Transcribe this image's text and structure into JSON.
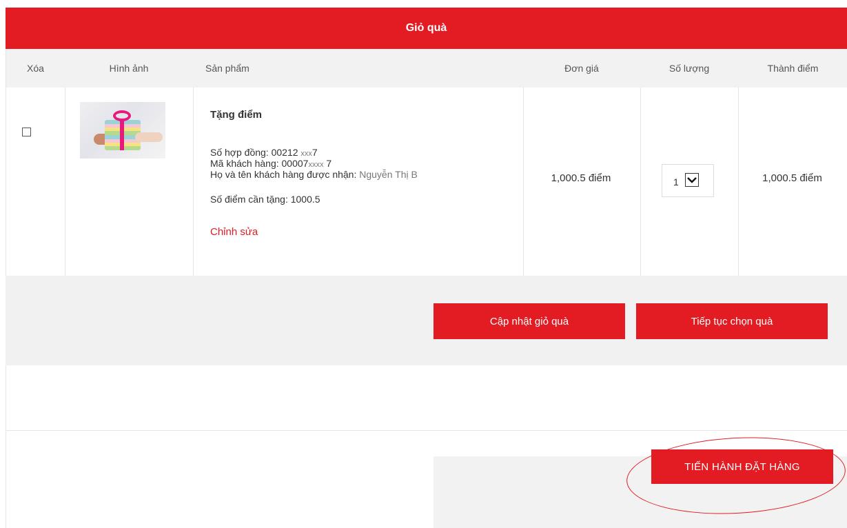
{
  "header": {
    "title": "Giỏ quà"
  },
  "table": {
    "columns": [
      "Xóa",
      "Hình ảnh",
      "Sản phẩm",
      "Đơn giá",
      "Số lượng",
      "Thành điểm"
    ],
    "row": {
      "product_title": "Tặng điểm",
      "contract_label": "Số hợp đồng: 00212",
      "contract_masked": "xxx",
      "contract_suffix": "7",
      "customer_label": "Mã khách hàng: 00007",
      "customer_masked": "xxxx",
      "customer_suffix": " 7",
      "recipient_label": "Họ và tên khách hàng được nhận:",
      "recipient_value": " Nguyễn Thị B",
      "points_label": "Số điểm cần tặng: 1000.5",
      "edit_label": "Chỉnh sửa",
      "unit_price": "1,000.5 điểm",
      "quantity": "1",
      "total": "1,000.5 điểm"
    }
  },
  "actions": {
    "update_label": "Cập nhật giỏ quà",
    "continue_label": "Tiếp tục chọn quà",
    "order_label": "TIẾN HÀNH ĐẶT HÀNG"
  },
  "colors": {
    "accent": "#e31b23",
    "band": "#f1f1f1"
  }
}
